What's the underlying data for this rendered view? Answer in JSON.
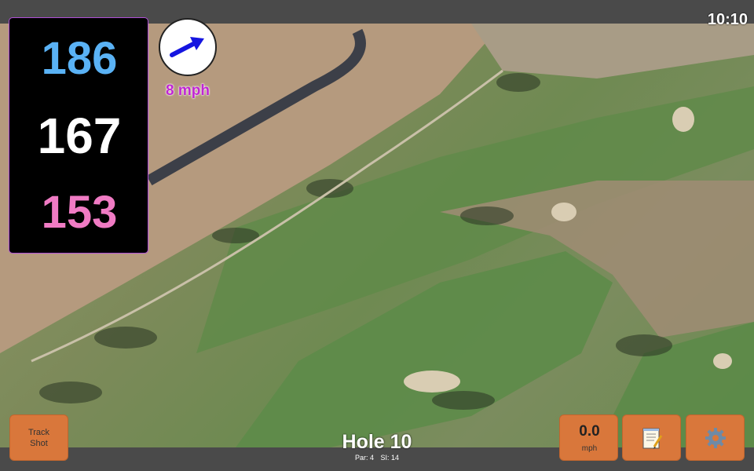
{
  "clock": {
    "time": "10:10"
  },
  "yardages": {
    "back": "186",
    "middle": "167",
    "front": "153"
  },
  "wind": {
    "speed": "8 mph",
    "direction_icon": "arrow-icon"
  },
  "buttons": {
    "track_shot_line1": "Track",
    "track_shot_line2": "Shot",
    "speed_value": "0.0",
    "speed_unit": "mph",
    "notes_icon": "notepad-icon",
    "settings_icon": "gear-icon"
  },
  "hole": {
    "title": "Hole 10",
    "par": "Par: 4",
    "si": "SI: 14"
  },
  "colors": {
    "back_yardage": "#5ab2f5",
    "middle_yardage": "#ffffff",
    "front_yardage": "#f07bc4",
    "button": "#d9773b",
    "wind_text": "#c026d3"
  }
}
